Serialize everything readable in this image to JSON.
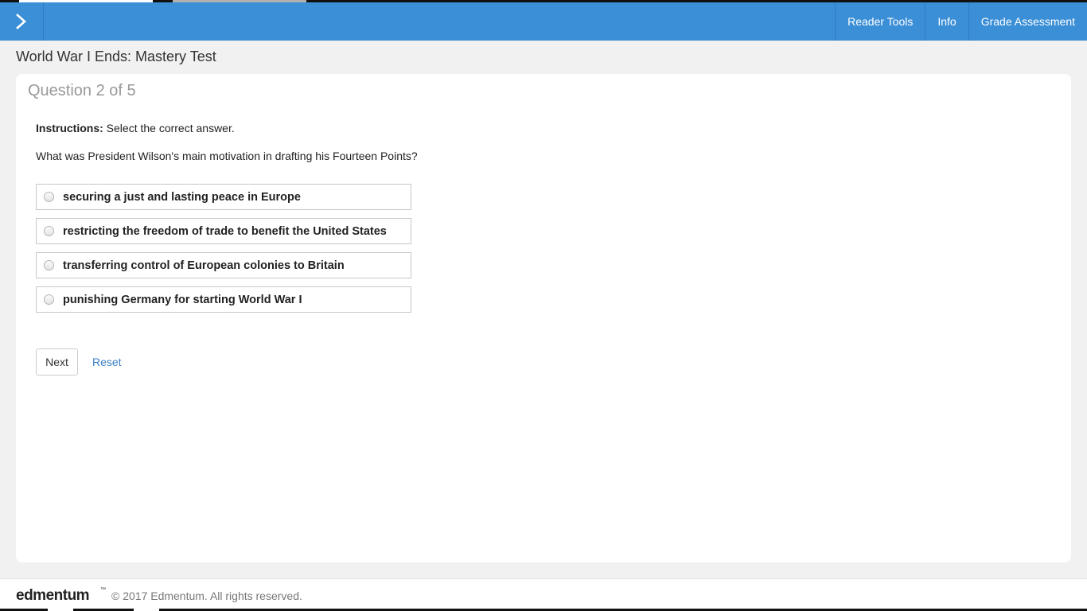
{
  "header": {
    "menu_icon": "chevron-right-icon",
    "nav": [
      {
        "label": "Reader Tools"
      },
      {
        "label": "Info"
      },
      {
        "label": "Grade Assessment"
      }
    ],
    "background": "#3b8fd6"
  },
  "page_title": "World War I Ends: Mastery Test",
  "question": {
    "counter": "Question 2 of 5",
    "instructions_label": "Instructions:",
    "instructions_text": "Select the correct answer.",
    "text": "What was President Wilson's main motivation in drafting his Fourteen Points?",
    "options": [
      {
        "label": "securing a just and lasting peace in Europe"
      },
      {
        "label": "restricting the freedom of trade to benefit the United States"
      },
      {
        "label": "transferring control of European colonies to Britain"
      },
      {
        "label": "punishing Germany for starting World War I"
      }
    ]
  },
  "actions": {
    "next_label": "Next",
    "reset_label": "Reset"
  },
  "footer": {
    "logo": "edmentum",
    "logo_mark": "™",
    "copyright": "© 2017 Edmentum. All rights reserved."
  }
}
